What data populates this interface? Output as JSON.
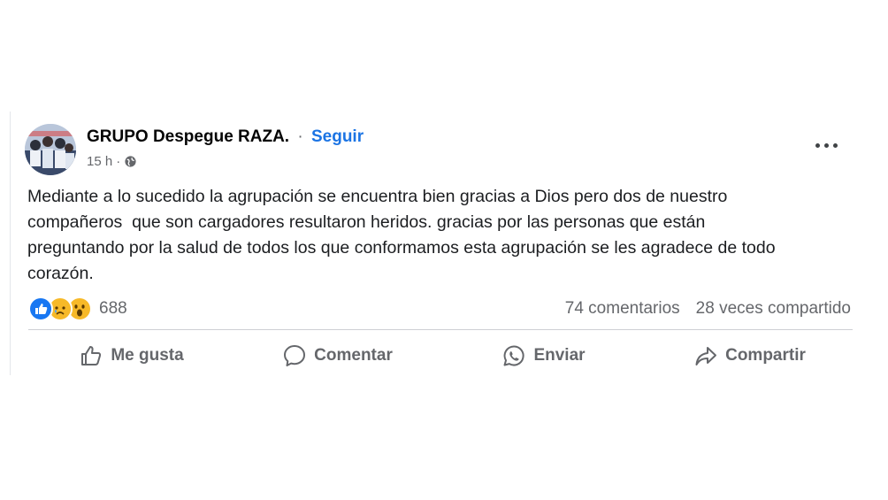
{
  "post": {
    "author": "GRUPO Despegue RAZA.",
    "separator": "·",
    "follow_label": "Seguir",
    "time": "15 h",
    "time_separator": "·",
    "audience_icon": "globe-icon",
    "more_icon": "more-options-icon",
    "text": "Mediante a lo sucedido la agrupación se encuentra bien gracias a Dios pero dos de nuestro\ncompañeros  que son cargadores resultaron heridos. gracias por las personas que están\npreguntando por la salud de todos los que conformamos esta agrupación se les agradece de todo\ncorazón."
  },
  "stats": {
    "reactions": [
      "like-reaction-icon",
      "sad-reaction-icon",
      "wow-reaction-icon"
    ],
    "reaction_count": "688",
    "comments": "74 comentarios",
    "shares": "28 veces compartido"
  },
  "actions": [
    {
      "label": "Me gusta",
      "icon": "thumbs-up-icon"
    },
    {
      "label": "Comentar",
      "icon": "comment-icon"
    },
    {
      "label": "Enviar",
      "icon": "whatsapp-icon"
    },
    {
      "label": "Compartir",
      "icon": "share-icon"
    }
  ],
  "colors": {
    "accent": "#1b74e4",
    "muted": "#65676b",
    "like_blue": "#1877f2",
    "emoji_yellow": "#f7b928"
  }
}
